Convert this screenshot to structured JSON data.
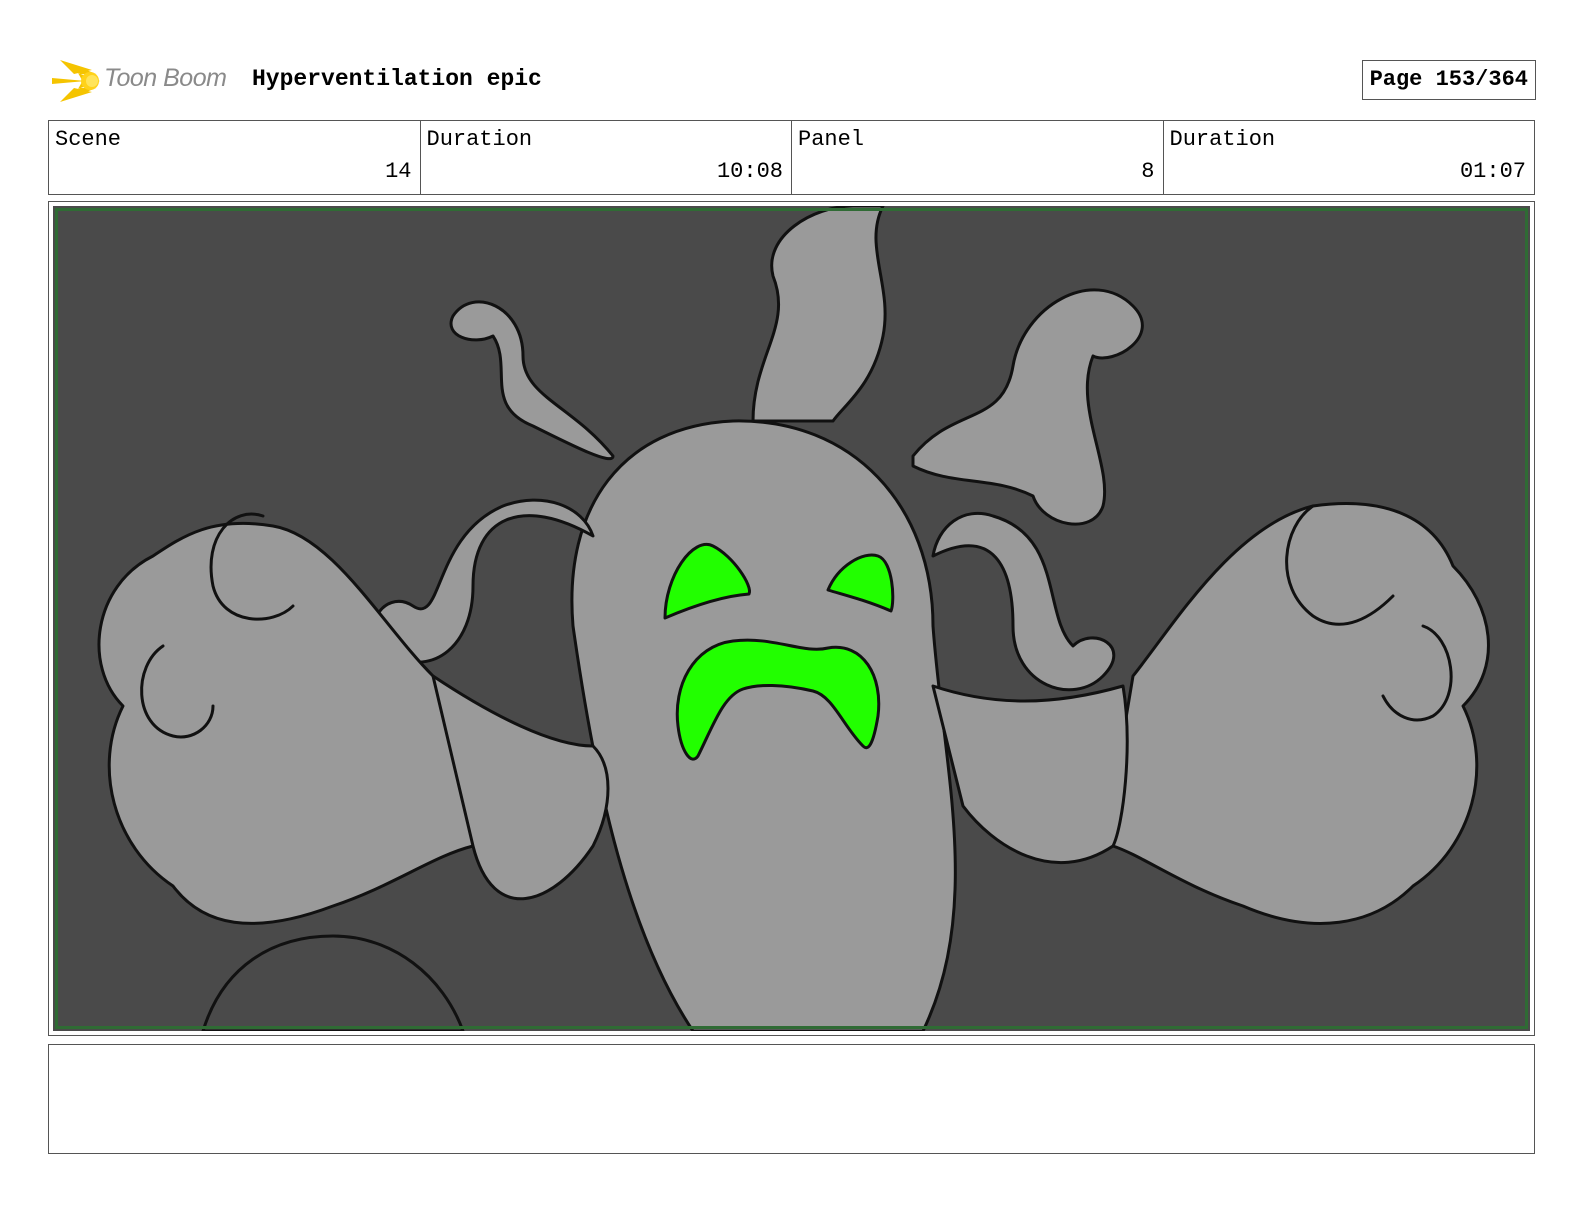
{
  "header": {
    "logo_text": "Toon Boom",
    "project_title": "Hyperventilation epic",
    "page_label": "Page 153/364"
  },
  "info": {
    "scene_label": "Scene",
    "scene_value": "14",
    "scene_duration_label": "Duration",
    "scene_duration_value": "10:08",
    "panel_label": "Panel",
    "panel_value": "8",
    "panel_duration_label": "Duration",
    "panel_duration_value": "01:07"
  },
  "panel": {
    "background_color": "#4a4a4a",
    "figure_color": "#9a9a9a",
    "accent_color": "#22ff00",
    "safe_area_color": "#2f6b34"
  },
  "notes": {
    "text": ""
  }
}
